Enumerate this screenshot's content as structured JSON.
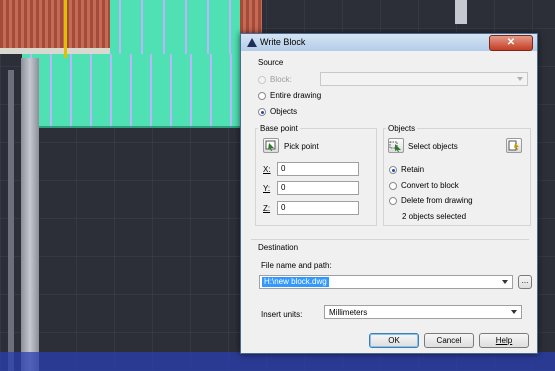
{
  "dialog": {
    "title": "Write Block",
    "close_label": "✕",
    "source": {
      "label": "Source",
      "block_label": "Block:",
      "entire_drawing_label": "Entire drawing",
      "objects_label": "Objects",
      "selected": "Objects"
    },
    "base_point": {
      "label": "Base point",
      "pick_point_label": "Pick point",
      "x_label": "X:",
      "y_label": "Y:",
      "z_label": "Z:",
      "x_value": "0",
      "y_value": "0",
      "z_value": "0"
    },
    "objects": {
      "label": "Objects",
      "select_objects_label": "Select objects",
      "retain_label": "Retain",
      "convert_label": "Convert to block",
      "delete_label": "Delete from drawing",
      "selected": "Retain",
      "status": "2 objects selected"
    },
    "destination": {
      "label": "Destination",
      "file_label": "File name and path:",
      "file_value": "H:\\new block.dwg",
      "browse_label": "...",
      "units_label": "Insert units:",
      "units_value": "Millimeters"
    },
    "buttons": {
      "ok": "OK",
      "cancel": "Cancel",
      "help": "Help"
    }
  },
  "colors": {
    "title_bar": "#b4cde8",
    "close_button": "#c43d22",
    "selection_highlight": "#3399ff",
    "wall_panel": "#4fe0b3",
    "slab": "#a54b3a"
  },
  "icons": {
    "title": "autocad-logo-icon",
    "pick_point": "pick-point-icon",
    "select_objects": "select-objects-icon",
    "quick_select": "quick-select-icon"
  }
}
